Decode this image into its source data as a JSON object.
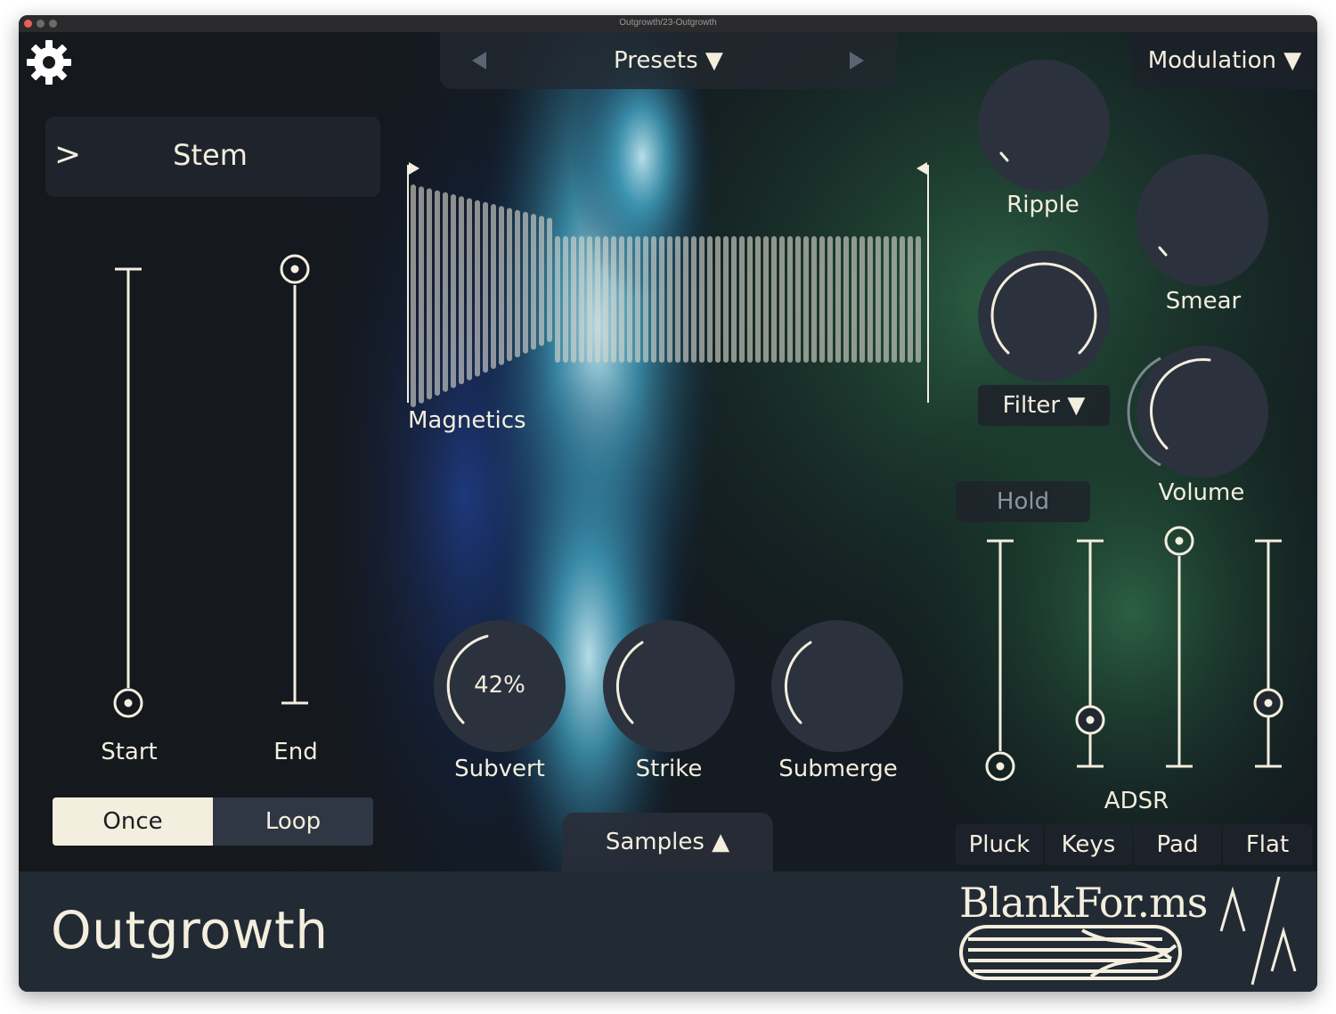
{
  "window": {
    "title": "Outgrowth/23-Outgrowth"
  },
  "colors": {
    "knob": "#2c323d",
    "cream": "#f3eedd",
    "panel": "#2a303a",
    "footer": "#222a34"
  },
  "header": {
    "presets_label": "Presets ▼",
    "modulation_label": "Modulation ▼"
  },
  "stem": {
    "label": "Stem",
    "toggle_icon": ">"
  },
  "sliders": {
    "start_label": "Start",
    "end_label": "End"
  },
  "playmode": {
    "once": "Once",
    "loop": "Loop",
    "selected": "Once"
  },
  "waveform": {
    "label": "Magnetics"
  },
  "knobs": {
    "subvert": {
      "label": "Subvert",
      "value": "42%"
    },
    "strike": {
      "label": "Strike"
    },
    "submerge": {
      "label": "Submerge"
    },
    "ripple": {
      "label": "Ripple"
    },
    "smear": {
      "label": "Smear"
    },
    "filter": {
      "label": "Filter ▼"
    },
    "volume": {
      "label": "Volume"
    }
  },
  "samples_label": "Samples ▲",
  "envelope": {
    "hold_label": "Hold",
    "adsr_label": "ADSR",
    "presets": [
      "Pluck",
      "Keys",
      "Pad",
      "Flat"
    ]
  },
  "footer": {
    "app_name": "Outgrowth",
    "brand": "BlankFor.ms"
  }
}
